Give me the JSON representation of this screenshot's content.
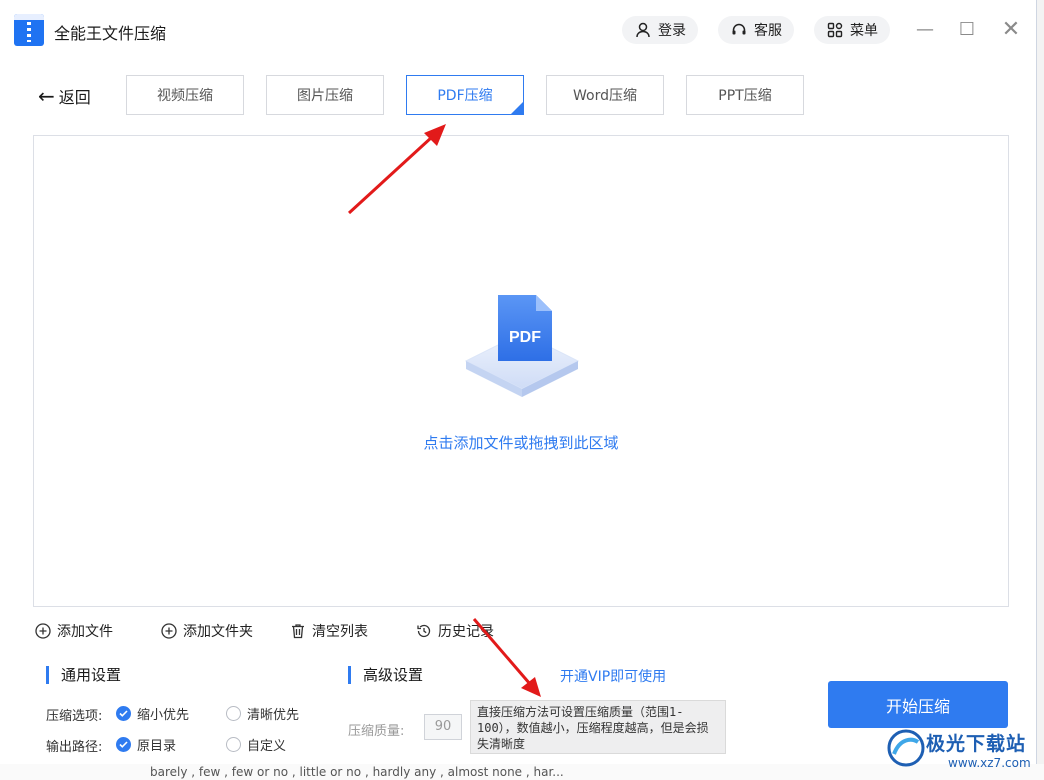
{
  "app": {
    "title": "全能王文件压缩"
  },
  "header": {
    "login": "登录",
    "service": "客服",
    "menu": "菜单"
  },
  "nav": {
    "back": "返回",
    "tabs": [
      {
        "label": "视频压缩",
        "active": false
      },
      {
        "label": "图片压缩",
        "active": false
      },
      {
        "label": "PDF压缩",
        "active": true
      },
      {
        "label": "Word压缩",
        "active": false
      },
      {
        "label": "PPT压缩",
        "active": false
      }
    ]
  },
  "drop_area": {
    "icon_text": "PDF",
    "hint": "点击添加文件或拖拽到此区域"
  },
  "toolbar": {
    "add_file": "添加文件",
    "add_folder": "添加文件夹",
    "clear_list": "清空列表",
    "history": "历史记录"
  },
  "general_settings": {
    "title": "通用设置",
    "compress_option_label": "压缩选项:",
    "option_small": "缩小优先",
    "option_clear": "清晰优先",
    "output_path_label": "输出路径:",
    "path_original": "原目录",
    "path_custom": "自定义"
  },
  "advanced_settings": {
    "title": "高级设置",
    "vip_link": "开通VIP即可使用",
    "quality_label": "压缩质量:",
    "quality_value": "90",
    "tooltip": "直接压缩方法可设置压缩质量（范围1-100），数值越小，压缩程度越高，但是会损失清晰度"
  },
  "start_button": "开始压缩",
  "background_text": "barely , few , few or no , little or no , hardly any , almost none , har...",
  "watermark": {
    "name": "极光下载站",
    "url": "www.xz7.com"
  },
  "colors": {
    "accent": "#2f7bf0",
    "arrow": "#e21a1a"
  }
}
